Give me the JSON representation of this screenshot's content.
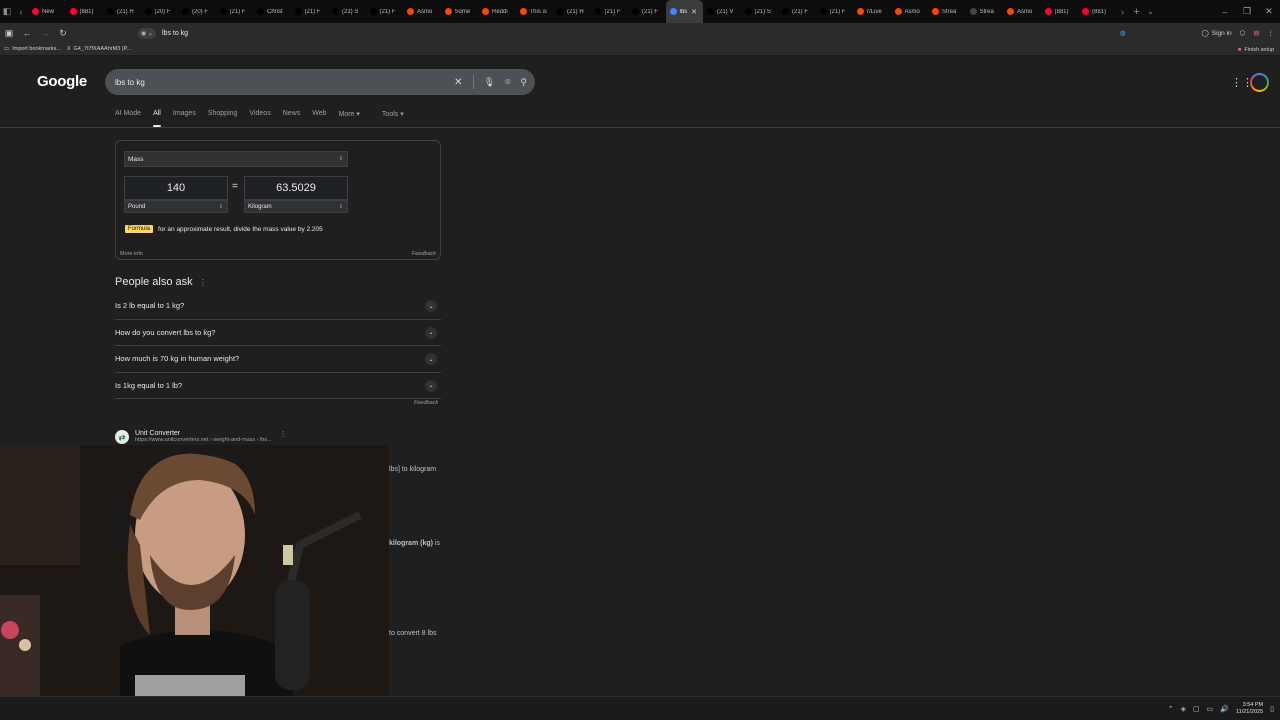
{
  "browser": {
    "tabs": [
      {
        "label": "New",
        "color": "#ff0033"
      },
      {
        "label": "(881)",
        "color": "#ff0033"
      },
      {
        "label": "(21) H",
        "color": "#000000"
      },
      {
        "label": "(20) F",
        "color": "#000000"
      },
      {
        "label": "(20) F",
        "color": "#000000"
      },
      {
        "label": "(21) F",
        "color": "#000000"
      },
      {
        "label": "Christ",
        "color": "#000000"
      },
      {
        "label": "(21) F",
        "color": "#000000"
      },
      {
        "label": "(21) S",
        "color": "#000000"
      },
      {
        "label": "(21) F",
        "color": "#000000"
      },
      {
        "label": "Asmo",
        "color": "#ff4500"
      },
      {
        "label": "Some",
        "color": "#ff4500"
      },
      {
        "label": "Reddi",
        "color": "#ff4500"
      },
      {
        "label": "This is",
        "color": "#ff4500"
      },
      {
        "label": "(21) H",
        "color": "#000000"
      },
      {
        "label": "(21) F",
        "color": "#000000"
      },
      {
        "label": "(21) F",
        "color": "#000000"
      },
      {
        "label": "lbs",
        "color": "#4285f4",
        "active": true
      },
      {
        "label": "(21) V",
        "color": "#000000"
      },
      {
        "label": "(21) S",
        "color": "#000000"
      },
      {
        "label": "(21) F",
        "color": "#000000"
      },
      {
        "label": "(21) F",
        "color": "#000000"
      },
      {
        "label": "r/Live",
        "color": "#ff4500"
      },
      {
        "label": "Asmo",
        "color": "#ff4500"
      },
      {
        "label": "Strea",
        "color": "#ff4500"
      },
      {
        "label": "Strea",
        "color": "#444444"
      },
      {
        "label": "Asmo",
        "color": "#ff4500"
      },
      {
        "label": "(881)",
        "color": "#ff0033"
      },
      {
        "label": "(881)",
        "color": "#ff0033"
      }
    ],
    "address": "lbs to kg",
    "sign_in": "Sign in",
    "bookmarks": [
      {
        "label": "Import bookmarks..."
      },
      {
        "label": "G4_7t7fXAAAhrM3 (P..."
      }
    ],
    "finish_setup": "Finish setup"
  },
  "google": {
    "logo": "Google",
    "query": "lbs to kg",
    "tabs": [
      "AI Mode",
      "All",
      "Images",
      "Shopping",
      "Videos",
      "News",
      "Web",
      "More ▾",
      "Tools ▾"
    ],
    "converter": {
      "quantity": "Mass",
      "from_value": "140",
      "to_value": "63.5029",
      "from_unit": "Pound",
      "to_unit": "Kilogram",
      "formula_badge": "Formula",
      "formula_text": "for an approximate result, divide the mass value by 2.205",
      "more_info": "More info",
      "feedback": "Feedback"
    },
    "paa": {
      "title": "People also ask",
      "questions": [
        "Is 2 lb equal to 1 kg?",
        "How do you convert lbs to kg?",
        "How much is 70 kg in human weight?",
        "Is 1kg equal to 1 lb?"
      ],
      "feedback": "Feedback"
    },
    "result": {
      "name": "Unit Converter",
      "url": "https://www.unitconverters.net › weight-and-mass › lbs...",
      "snippet1": "lbs] to kilogram",
      "snippet2a": "kilogram",
      "snippet2b": "(kg)",
      "snippet2c": " is",
      "snippet3": "to convert 8 lbs"
    }
  },
  "taskbar": {
    "time": "3:54 PM",
    "date": "11/21/2025"
  }
}
